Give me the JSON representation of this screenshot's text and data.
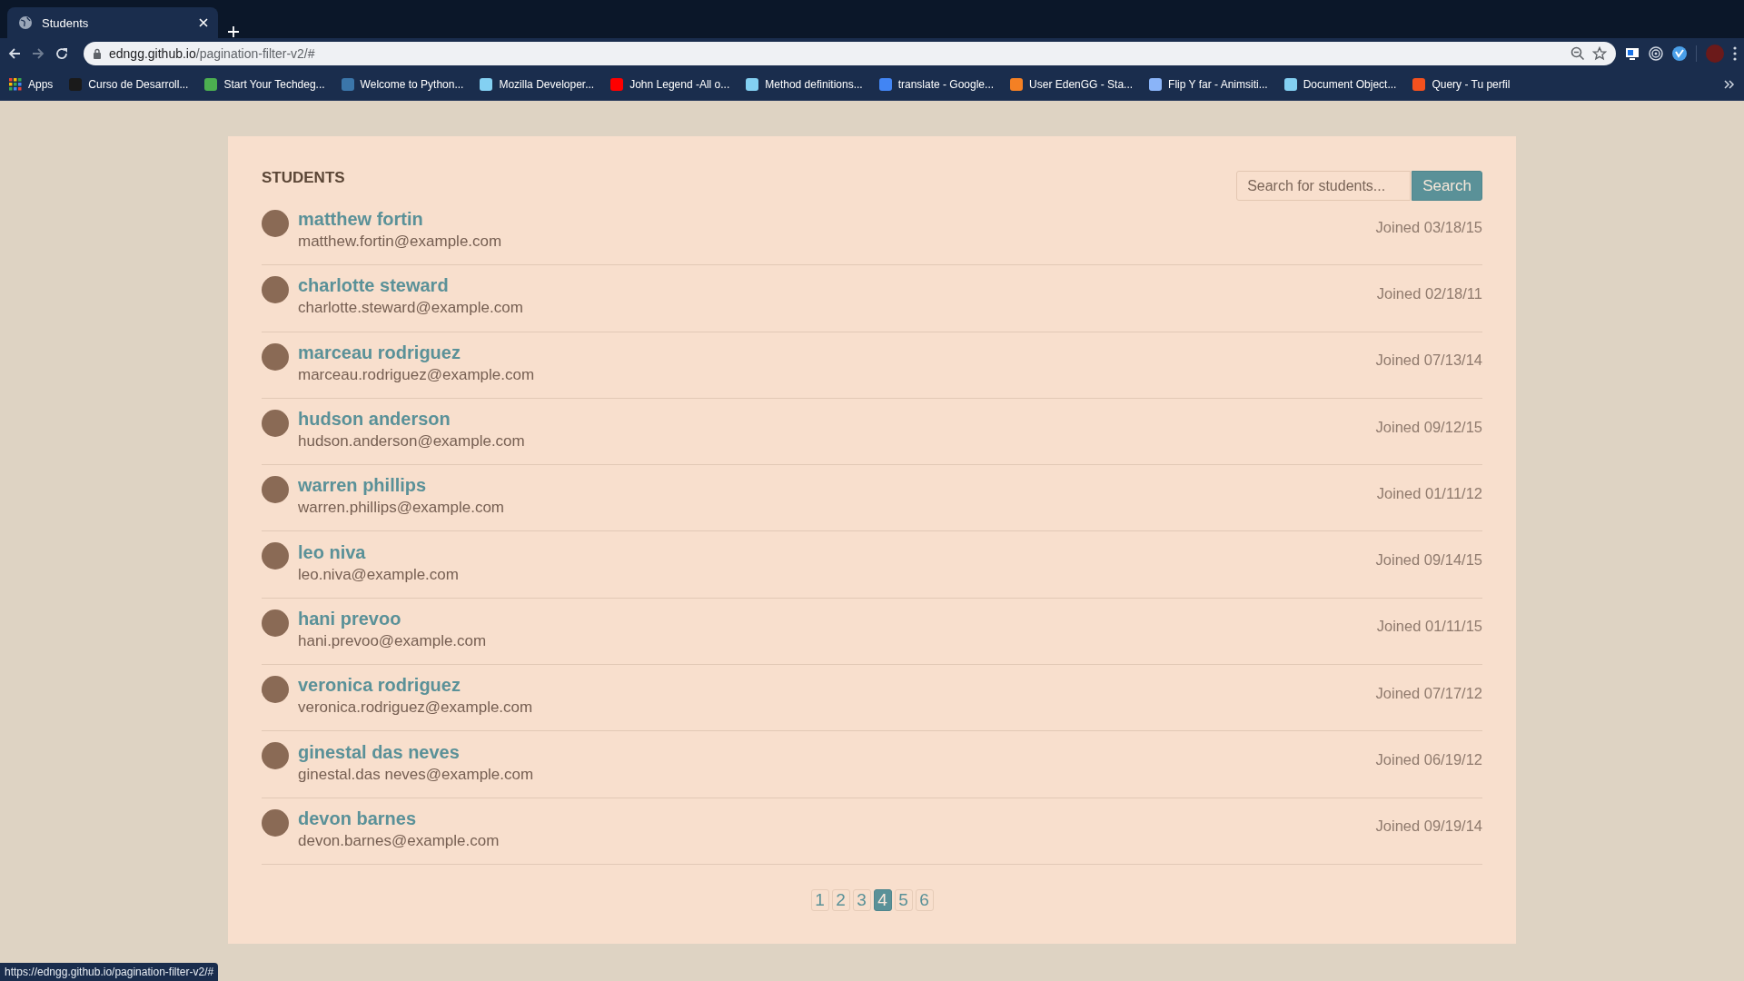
{
  "browser": {
    "tab": {
      "title": "Students",
      "selected": true
    },
    "address": {
      "host": "edngg.github.io",
      "path": "/pagination-filter-v2/#"
    },
    "bookmarks": [
      {
        "label": "Apps",
        "kind": "apps"
      },
      {
        "label": "Curso de Desarroll...",
        "kind": "site",
        "color": "#1a1a1a"
      },
      {
        "label": "Start Your Techdeg...",
        "kind": "site",
        "color": "#4caf50"
      },
      {
        "label": "Welcome to Python...",
        "kind": "site",
        "color": "#3b76aa"
      },
      {
        "label": "Mozilla Developer...",
        "kind": "site",
        "color": "#83d0f2"
      },
      {
        "label": "John Legend -All o...",
        "kind": "site",
        "color": "#ff0000"
      },
      {
        "label": "Method definitions...",
        "kind": "site",
        "color": "#83d0f2"
      },
      {
        "label": "translate - Google...",
        "kind": "site",
        "color": "#4285f4"
      },
      {
        "label": "User EdenGG - Sta...",
        "kind": "site",
        "color": "#f48024"
      },
      {
        "label": "Flip Y far - Animsiti...",
        "kind": "site",
        "color": "#8ab4f8"
      },
      {
        "label": "Document Object...",
        "kind": "site",
        "color": "#83d0f2"
      },
      {
        "label": "Query - Tu perfil",
        "kind": "site",
        "color": "#f4511e"
      }
    ],
    "status_url": "https://edngg.github.io/pagination-filter-v2/#"
  },
  "page": {
    "heading": "STUDENTS",
    "search": {
      "placeholder": "Search for students...",
      "button": "Search"
    },
    "students": [
      {
        "name": "matthew fortin",
        "email": "matthew.fortin@example.com",
        "joined": "Joined 03/18/15"
      },
      {
        "name": "charlotte steward",
        "email": "charlotte.steward@example.com",
        "joined": "Joined 02/18/11"
      },
      {
        "name": "marceau rodriguez",
        "email": "marceau.rodriguez@example.com",
        "joined": "Joined 07/13/14"
      },
      {
        "name": "hudson anderson",
        "email": "hudson.anderson@example.com",
        "joined": "Joined 09/12/15"
      },
      {
        "name": "warren phillips",
        "email": "warren.phillips@example.com",
        "joined": "Joined 01/11/12"
      },
      {
        "name": "leo niva",
        "email": "leo.niva@example.com",
        "joined": "Joined 09/14/15"
      },
      {
        "name": "hani prevoo",
        "email": "hani.prevoo@example.com",
        "joined": "Joined 01/11/15"
      },
      {
        "name": "veronica rodriguez",
        "email": "veronica.rodriguez@example.com",
        "joined": "Joined 07/17/12"
      },
      {
        "name": "ginestal das neves",
        "email": "ginestal.das neves@example.com",
        "joined": "Joined 06/19/12"
      },
      {
        "name": "devon barnes",
        "email": "devon.barnes@example.com",
        "joined": "Joined 09/19/14"
      }
    ],
    "pages": [
      {
        "label": "1",
        "selected": false
      },
      {
        "label": "2",
        "selected": false
      },
      {
        "label": "3",
        "selected": false
      },
      {
        "label": "4",
        "selected": true
      },
      {
        "label": "5",
        "selected": false
      },
      {
        "label": "6",
        "selected": false
      }
    ]
  }
}
